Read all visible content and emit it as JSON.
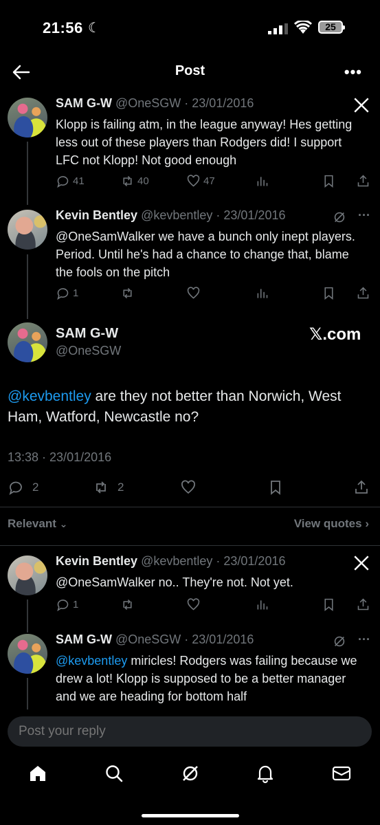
{
  "status_bar": {
    "time": "21:56",
    "battery": "25"
  },
  "header": {
    "title": "Post",
    "more": "•••"
  },
  "parents": [
    {
      "name": "SAM G-W",
      "meta": "@OneSGW · 23/01/2016",
      "text": "Klopp is failing atm, in the league anyway! Hes getting less out of these players than Rodgers did! I support LFC not Klopp! Not good enough",
      "replies": "41",
      "reposts": "40",
      "likes": "47"
    },
    {
      "name": "Kevin Bentley",
      "meta": "@kevbentley · 23/01/2016",
      "text": "@OneSamWalker we have a bunch only inept players. Period. Until he's had a chance to change that, blame the fools on the pitch",
      "replies": "1",
      "reposts": "",
      "likes": ""
    }
  ],
  "main": {
    "name": "SAM G-W",
    "handle": "@OneSGW",
    "badge": "𝕏.com",
    "mention": "@kevbentley",
    "text": " are they not better than Norwich, West Ham, Watford, Newcastle no?",
    "timestamp": "13:38 · 23/01/2016",
    "replies": "2",
    "reposts": "2"
  },
  "filter": {
    "sort": "Relevant",
    "view_quotes": "View quotes"
  },
  "replies": [
    {
      "name": "Kevin Bentley",
      "meta": "@kevbentley · 23/01/2016",
      "text": "@OneSamWalker no.. They're not. Not yet.",
      "replies": "1"
    },
    {
      "name": "SAM G-W",
      "meta": "@OneSGW · 23/01/2016",
      "mention": "@kevbentley",
      "text": " miricles! Rodgers was failing because we drew a lot! Klopp is supposed to be a better manager and we are heading for bottom half"
    }
  ],
  "composer": {
    "placeholder": "Post your reply"
  },
  "nav": [
    "home-icon",
    "search-icon",
    "grok-icon",
    "notifications-icon",
    "messages-icon"
  ]
}
